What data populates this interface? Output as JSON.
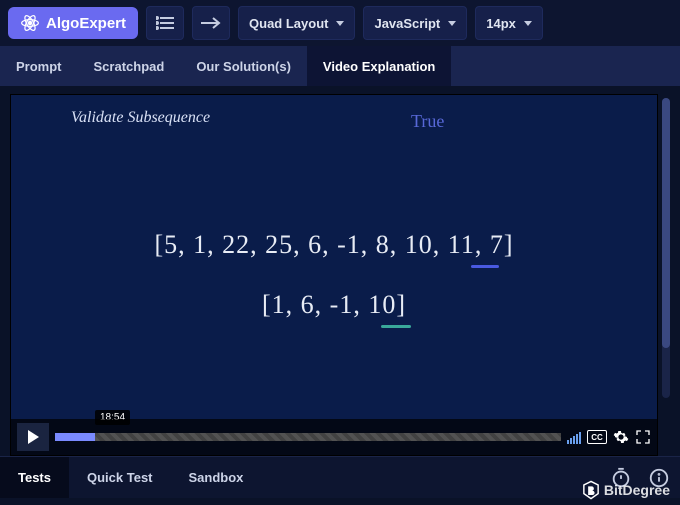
{
  "brand": "AlgoExpert",
  "toolbar": {
    "layout_label": "Quad Layout",
    "language_label": "JavaScript",
    "fontsize_label": "14px"
  },
  "tabs": [
    {
      "label": "Prompt"
    },
    {
      "label": "Scratchpad"
    },
    {
      "label": "Our Solution(s)"
    },
    {
      "label": "Video Explanation"
    }
  ],
  "active_tab_index": 3,
  "video": {
    "title": "Validate Subsequence",
    "annotation_true": "True",
    "handwriting_line1": "[5, 1, 22, 25, 6, -1, 8, 10, 11, 7]",
    "handwriting_line2": "[1, 6, -1, 10]",
    "timestamp": "18:54",
    "cc_label": "CC"
  },
  "bottom_tabs": [
    {
      "label": "Tests"
    },
    {
      "label": "Quick Test"
    },
    {
      "label": "Sandbox"
    }
  ],
  "active_bottom_tab_index": 0,
  "watermark": "BitDegree"
}
